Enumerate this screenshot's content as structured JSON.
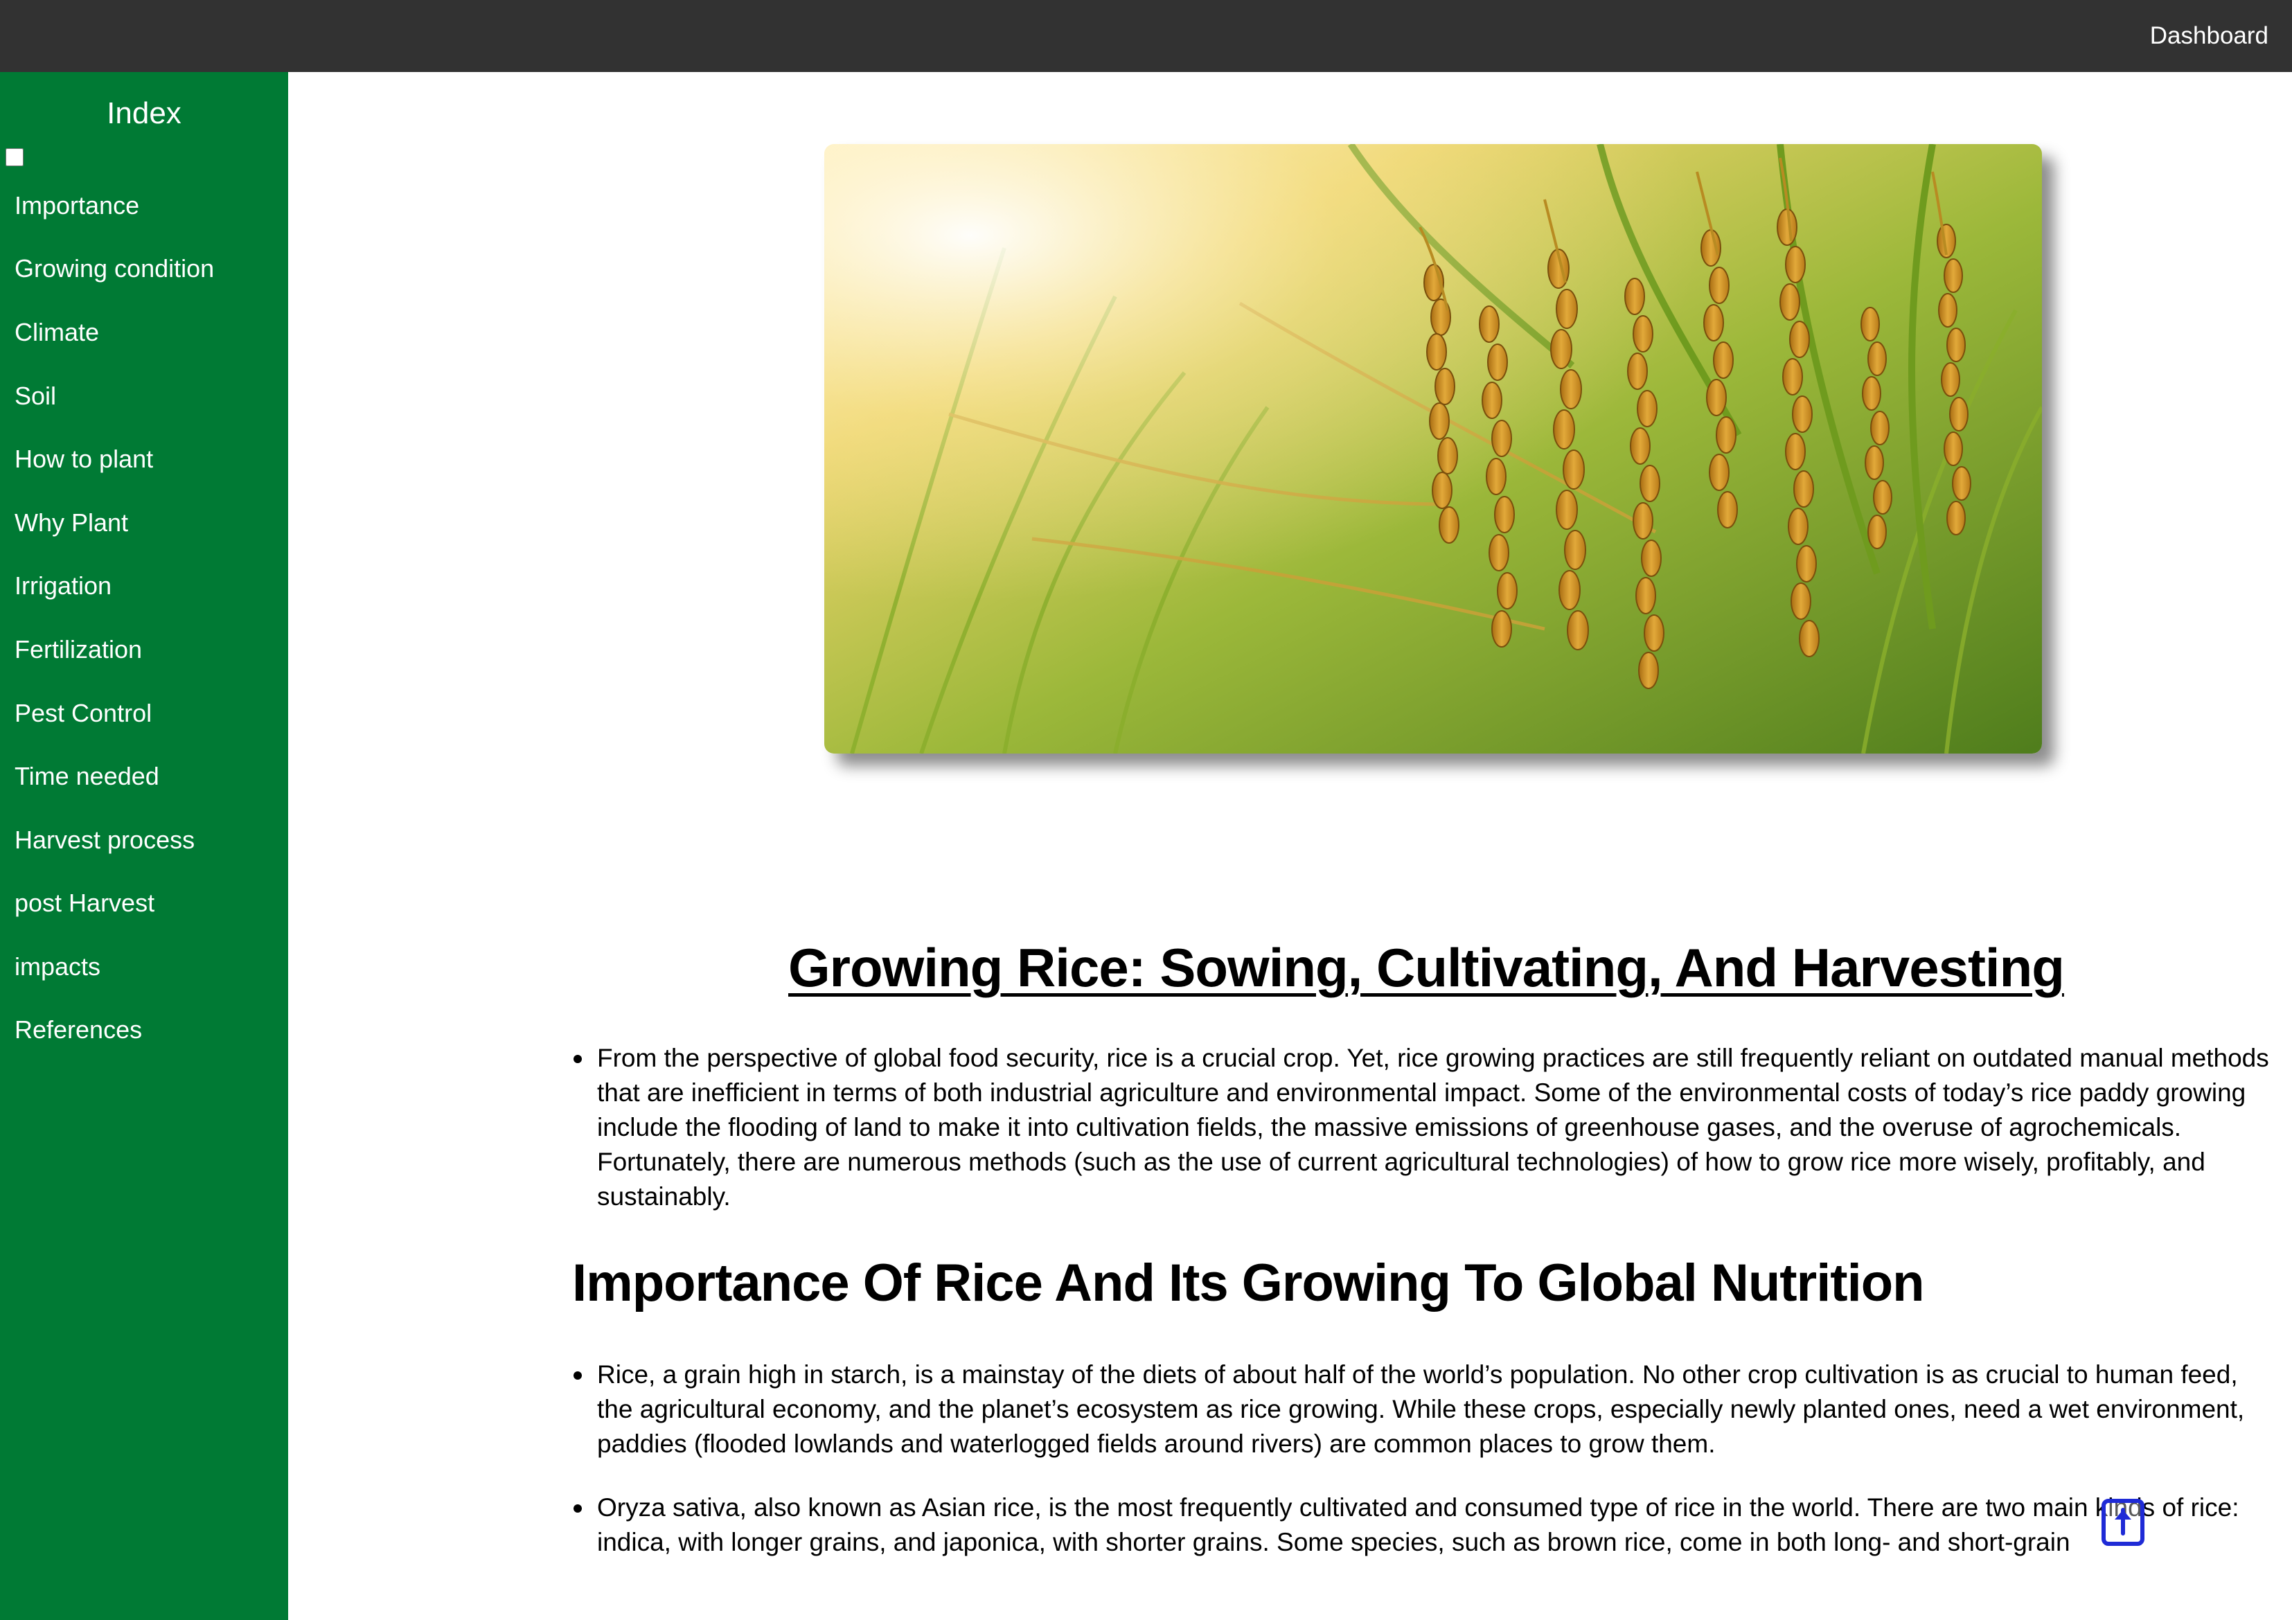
{
  "topbar": {
    "dashboard_label": "Dashboard"
  },
  "sidebar": {
    "title": "Index",
    "toggle_checked": false,
    "items": [
      {
        "label": "Importance"
      },
      {
        "label": "Growing condition"
      },
      {
        "label": "Climate"
      },
      {
        "label": "Soil"
      },
      {
        "label": "How to plant"
      },
      {
        "label": "Why Plant"
      },
      {
        "label": "Irrigation"
      },
      {
        "label": "Fertilization"
      },
      {
        "label": "Pest Control"
      },
      {
        "label": "Time needed"
      },
      {
        "label": "Harvest process"
      },
      {
        "label": "post Harvest"
      },
      {
        "label": "impacts"
      },
      {
        "label": "References"
      }
    ]
  },
  "main": {
    "hero_image": "rice-field-photo",
    "title": "Growing Rice: Sowing, Cultivating, And Harvesting",
    "intro_paragraphs": [
      "From the perspective of global food security, rice is a crucial crop. Yet, rice growing practices are still frequently reliant on outdated manual methods that are inefficient in terms of both industrial agriculture and environmental impact. Some of the environmental costs of today’s rice paddy growing include the flooding of land to make it into cultivation fields, the massive emissions of greenhouse gases, and the overuse of agrochemicals. Fortunately, there are numerous methods (such as the use of current agricultural technologies) of how to grow rice more wisely, profitably, and sustainably."
    ],
    "section_importance": {
      "heading": "Importance Of Rice And Its Growing To Global Nutrition",
      "paragraphs": [
        "Rice, a grain high in starch, is a mainstay of the diets of about half of the world’s population. No other crop cultivation is as crucial to human feed, the agricultural economy, and the planet’s ecosystem as rice growing. While these crops, especially newly planted ones, need a wet environment, paddies (flooded lowlands and waterlogged fields around rivers) are common places to grow them.",
        "Oryza sativa, also known as Asian rice, is the most frequently cultivated and consumed type of rice in the world. There are two main kinds of rice: indica, with longer grains, and japonica, with shorter grains. Some species, such as brown rice, come in both long- and short-grain"
      ]
    }
  },
  "scroll_top_icon": "arrow-up-icon",
  "colors": {
    "topbar": "#323232",
    "sidebar": "#007a34",
    "scroll_top_border": "#1f2bd6"
  }
}
